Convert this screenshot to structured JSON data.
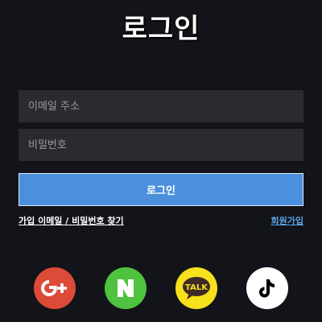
{
  "title": "로그인",
  "form": {
    "email_placeholder": "이메일 주소",
    "password_placeholder": "비밀번호",
    "submit_label": "로그인"
  },
  "links": {
    "find_account": "가입 이메일 / 비밀번호 찾기",
    "signup": "회원가입"
  },
  "social": [
    {
      "icon": "google-plus-icon",
      "color": "#dc4a38"
    },
    {
      "icon": "naver-icon",
      "color": "#4fc23f"
    },
    {
      "icon": "kakaotalk-icon",
      "color": "#f7e01c",
      "text": "TALK"
    },
    {
      "icon": "tiktok-icon",
      "color": "#ffffff"
    }
  ],
  "colors": {
    "background": "#131419",
    "input_background": "#2a2b31",
    "primary": "#4a90dc",
    "link_accent": "#5aa2e6"
  }
}
